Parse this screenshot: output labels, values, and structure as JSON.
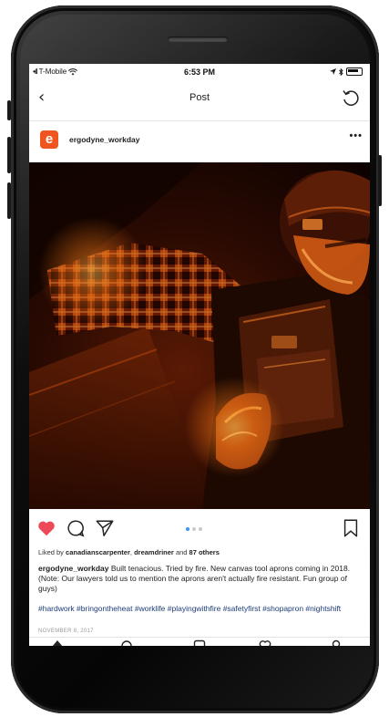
{
  "status_bar": {
    "carrier": "T-Mobile",
    "time": "6:53 PM"
  },
  "nav": {
    "back_glyph": "‹",
    "title": "Post",
    "refresh_icon": "refresh-icon"
  },
  "post": {
    "avatar_letter": "e",
    "username": "ergodyne_workday",
    "more_glyph": "•••",
    "image_description_icon": "photo",
    "likes": {
      "prefix": "Liked by ",
      "user1": "canadianscarpenter",
      "sep": ", ",
      "user2": "dreamdriner",
      "and": " and ",
      "others": "87 others"
    },
    "caption_user": "ergodyne_workday",
    "caption_text": " Built tenacious. Tried by fire. New canvas tool aprons coming in 2018. (Note: Our lawyers told us to mention the aprons aren't actually fire resistant. Fun group of guys)",
    "hashtags": "#hardwork #bringontheheat #worklife #playingwithfire #safetyfirst #shopapron #nightshift",
    "date": "NOVEMBER 8, 2017"
  },
  "carousel": {
    "count": 3,
    "active": 1
  },
  "colors": {
    "like_red": "#ed4956",
    "brand_orange": "#f0551f",
    "hashtag_blue": "#1d3c7a",
    "dot_active": "#3897f0"
  }
}
